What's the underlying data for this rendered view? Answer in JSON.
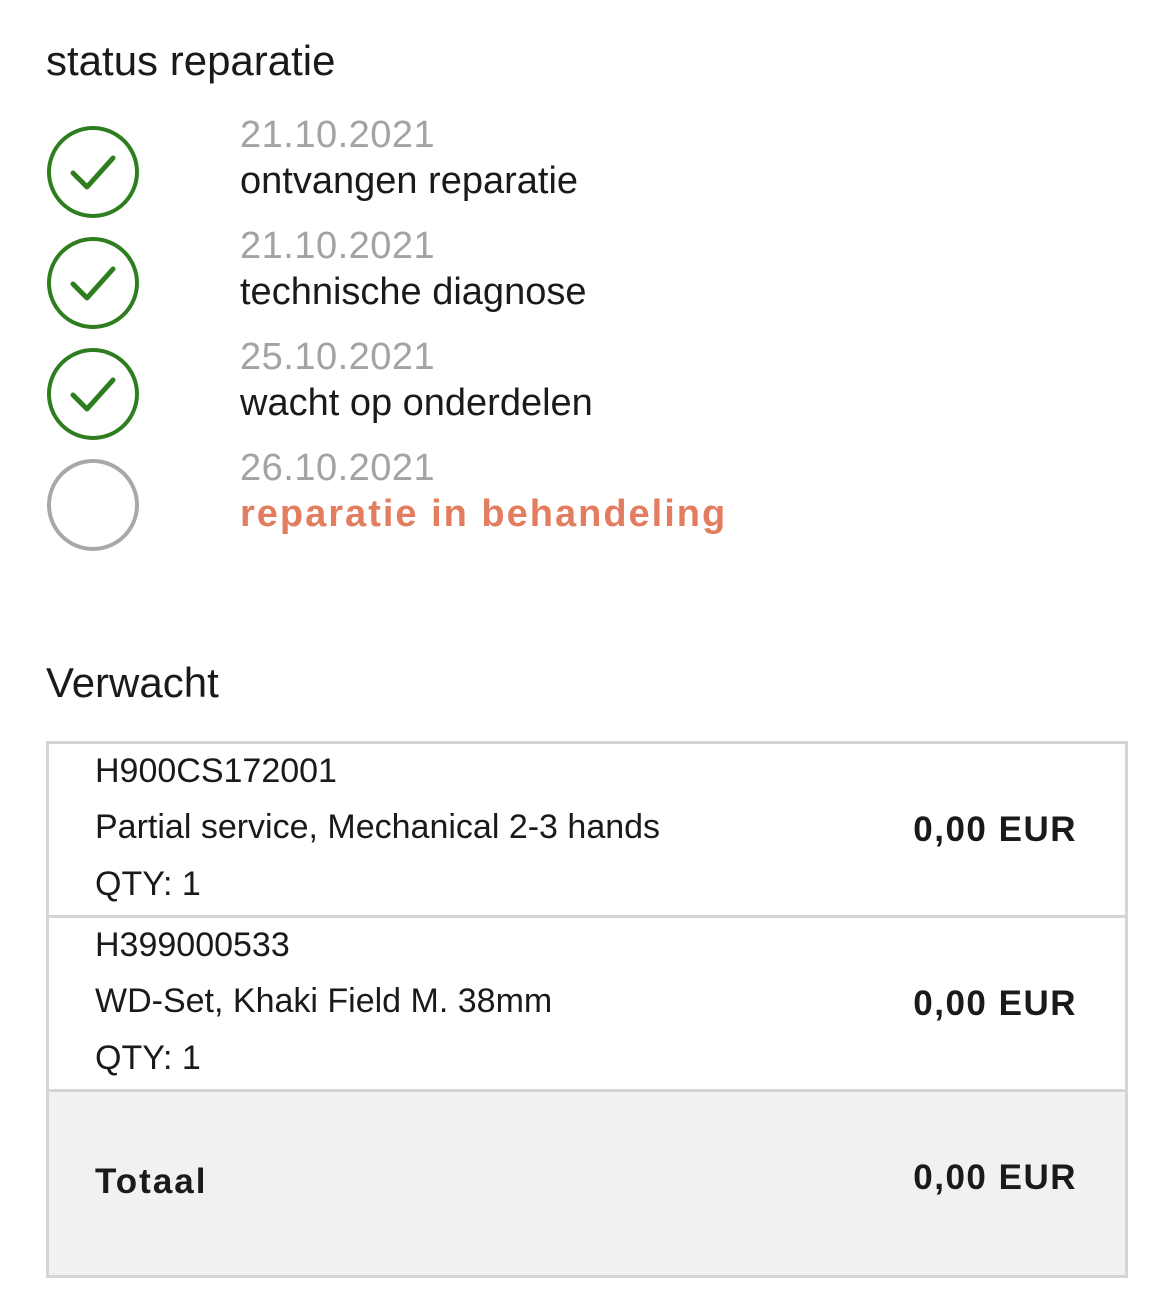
{
  "status": {
    "title": "status reparatie",
    "steps": [
      {
        "date": "21.10.2021",
        "label": "ontvangen reparatie",
        "state": "done",
        "icon": "check-circle-icon"
      },
      {
        "date": "21.10.2021",
        "label": "technische diagnose",
        "state": "done",
        "icon": "check-circle-icon"
      },
      {
        "date": "25.10.2021",
        "label": "wacht op onderdelen",
        "state": "done",
        "icon": "check-circle-icon"
      },
      {
        "date": "26.10.2021",
        "label": "reparatie in behandeling",
        "state": "current",
        "icon": "empty-circle-icon"
      }
    ]
  },
  "expected": {
    "title": "Verwacht",
    "items": [
      {
        "code": "H900CS172001",
        "description": "Partial service, Mechanical 2-3 hands",
        "qty": "QTY: 1",
        "price": "0,00 EUR"
      },
      {
        "code": "H399000533",
        "description": "WD-Set, Khaki Field M. 38mm",
        "qty": "QTY: 1",
        "price": "0,00 EUR"
      }
    ],
    "total_label": "Totaal",
    "total_value": "0,00 EUR"
  },
  "colors": {
    "done": "#2e7d1f",
    "pending": "#a8a8a8",
    "current_text": "#e27d60",
    "muted_text": "#a3a3a3"
  }
}
